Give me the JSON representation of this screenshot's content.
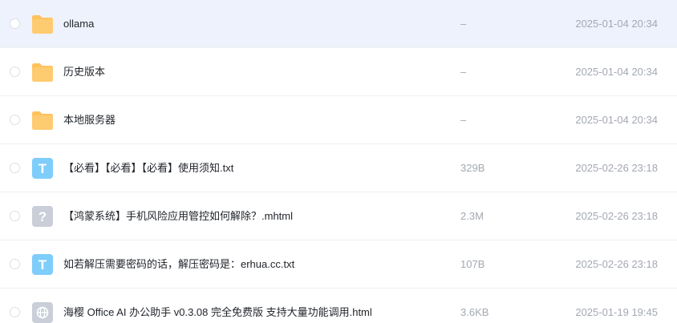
{
  "files": [
    {
      "name": "ollama",
      "size": "–",
      "modified": "2025-01-04 20:34",
      "icon": "folder-icon",
      "selected": true
    },
    {
      "name": "历史版本",
      "size": "–",
      "modified": "2025-01-04 20:34",
      "icon": "folder-icon"
    },
    {
      "name": "本地服务器",
      "size": "–",
      "modified": "2025-01-04 20:34",
      "icon": "folder-icon"
    },
    {
      "name": "【必看】【必看】【必看】使用须知.txt",
      "size": "329B",
      "modified": "2025-02-26 23:18",
      "icon": "text-file-icon",
      "icon_letter": "T"
    },
    {
      "name": "【鸿蒙系统】手机风险应用管控如何解除？.mhtml",
      "size": "2.3M",
      "modified": "2025-02-26 23:18",
      "icon": "unknown-file-icon",
      "icon_letter": "?"
    },
    {
      "name": "如若解压需要密码的话，解压密码是：erhua.cc.txt",
      "size": "107B",
      "modified": "2025-02-26 23:18",
      "icon": "text-file-icon",
      "icon_letter": "T"
    },
    {
      "name": "海樱 Office AI 办公助手 v0.3.08 完全免费版 支持大量功能调用.html",
      "size": "3.6KB",
      "modified": "2025-01-19 19:45",
      "icon": "web-file-icon"
    }
  ],
  "colors": {
    "folder": "#ffc25c",
    "text_file": "#7fcdfb",
    "unknown_file": "#c9ced8",
    "web_file": "#c9ced8",
    "selected_row": "#eef2fd"
  }
}
